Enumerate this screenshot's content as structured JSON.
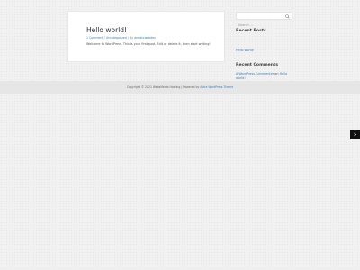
{
  "post": {
    "title": "Hello world!",
    "comments_link": "1 Comment",
    "separator_1": " / ",
    "category_link": "Uncategorized",
    "separator_2": " / By ",
    "author_link": "wmixtcwebdev",
    "excerpt": "Welcome to WordPress. This is your first post. Edit or delete it, then start writing!"
  },
  "sidebar": {
    "search": {
      "placeholder": "Search ...",
      "icon": "search-icon"
    },
    "recent_posts": {
      "title": "Recent Posts",
      "items": [
        {
          "label": "Hello world!"
        }
      ]
    },
    "recent_comments": {
      "title": "Recent Comments",
      "items": [
        {
          "author": "A WordPress Commenter",
          "on_text": " on ",
          "post": "Hello world!"
        }
      ]
    }
  },
  "footer": {
    "copyright": "Copyright © 2021 WebsMedia Hosting | Powered by ",
    "theme_link": "Astra WordPress Theme"
  },
  "floating_button": {
    "icon": "chevron-icon"
  },
  "colors": {
    "link": "#3a7ec1",
    "background": "#f1f1f1",
    "card": "#ffffff",
    "footer_band": "#e6e6e6",
    "floating_button": "#111111"
  }
}
